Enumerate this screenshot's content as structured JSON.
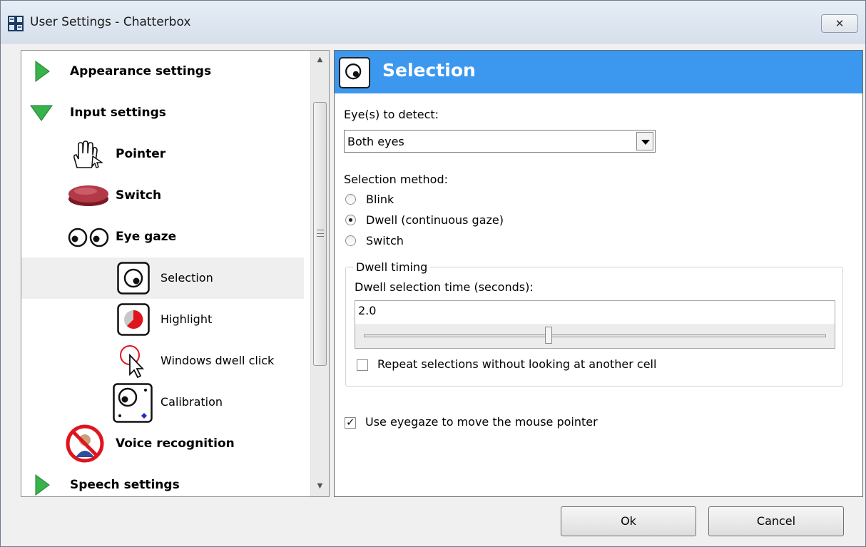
{
  "window": {
    "title": "User Settings - Chatterbox",
    "close_label": "✕"
  },
  "tree": {
    "items": [
      {
        "label": "Appearance settings",
        "icon": "triangle-right-icon",
        "level": 0
      },
      {
        "label": "Input settings",
        "icon": "triangle-down-icon",
        "level": 0
      },
      {
        "label": "Pointer",
        "icon": "hand-pointer-icon",
        "level": 1
      },
      {
        "label": "Switch",
        "icon": "switch-button-icon",
        "level": 1
      },
      {
        "label": "Eye gaze",
        "icon": "eyes-icon",
        "level": 1
      },
      {
        "label": "Selection",
        "icon": "eye-selection-icon",
        "level": 2,
        "selected": true
      },
      {
        "label": "Highlight",
        "icon": "pie-highlight-icon",
        "level": 2
      },
      {
        "label": "Windows dwell click",
        "icon": "dwell-click-icon",
        "level": 2
      },
      {
        "label": "Calibration",
        "icon": "calibration-icon",
        "level": 2
      },
      {
        "label": "Voice recognition",
        "icon": "voice-disabled-icon",
        "level": 1
      },
      {
        "label": "Speech settings",
        "icon": "triangle-right-icon",
        "level": 0
      }
    ]
  },
  "panel": {
    "title": "Selection",
    "eyes_label": "Eye(s) to detect:",
    "eyes_value": "Both eyes",
    "method_label": "Selection method:",
    "methods": [
      {
        "label": "Blink",
        "checked": false
      },
      {
        "label": "Dwell (continuous gaze)",
        "checked": true
      },
      {
        "label": "Switch",
        "checked": false
      }
    ],
    "dwell_group": "Dwell timing",
    "dwell_time_label": "Dwell selection time (seconds):",
    "dwell_time_value": "2.0",
    "dwell_slider_fraction": 0.4,
    "repeat_label": "Repeat selections without looking at another cell",
    "repeat_checked": false,
    "mouse_label": "Use eyegaze to move the mouse pointer",
    "mouse_checked": true
  },
  "buttons": {
    "ok": "Ok",
    "cancel": "Cancel"
  },
  "colors": {
    "header_blue": "#3c97ef",
    "tree_green": "#38b24a"
  }
}
